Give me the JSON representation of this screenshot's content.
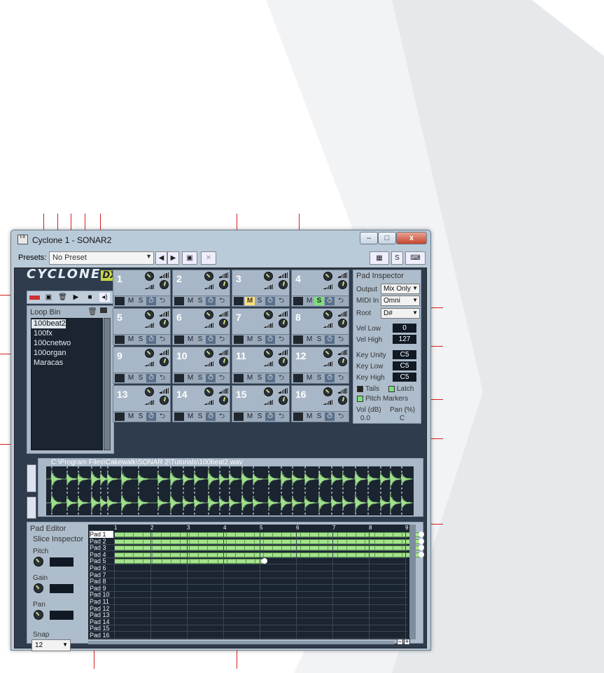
{
  "window": {
    "title": "Cyclone 1 - SONAR2",
    "sys_icon": "FX",
    "min_btn": "–",
    "max_btn": "□",
    "close_btn": "x"
  },
  "presets": {
    "label": "Presets:",
    "value": "No Preset",
    "prev": "◀",
    "next": "▶",
    "save_icon": "save-icon",
    "delete": "✕",
    "s_label": "S"
  },
  "logo": {
    "text": "CYCLONE",
    "dx": "DX",
    "i": "i"
  },
  "loop_bin": {
    "title": "Loop Bin",
    "items": [
      "100beat2",
      "100fx",
      "100cnetwo",
      "100organ",
      "Maracas"
    ],
    "selected": 0
  },
  "pads": [
    {
      "num": "1"
    },
    {
      "num": "2"
    },
    {
      "num": "3",
      "mute": true
    },
    {
      "num": "4"
    },
    {
      "num": "5"
    },
    {
      "num": "6"
    },
    {
      "num": "7"
    },
    {
      "num": "8"
    },
    {
      "num": "9"
    },
    {
      "num": "10"
    },
    {
      "num": "11"
    },
    {
      "num": "12"
    },
    {
      "num": "13"
    },
    {
      "num": "14"
    },
    {
      "num": "15"
    },
    {
      "num": "16"
    }
  ],
  "pad4_solo": true,
  "pad_buttons": {
    "m": "M",
    "s": "S",
    "clock": "⏱",
    "loop": "⮌"
  },
  "inspector": {
    "title": "Pad Inspector",
    "output_label": "Output",
    "output_value": "Mix Only",
    "midi_label": "MIDI In",
    "midi_value": "Omni",
    "root_label": "Root",
    "root_value": "D#",
    "vel_low_label": "Vel Low",
    "vel_low": "0",
    "vel_high_label": "Vel High",
    "vel_high": "127",
    "key_unity_label": "Key Unity",
    "key_unity": "C5",
    "key_low_label": "Key Low",
    "key_low": "C5",
    "key_high_label": "Key High",
    "key_high": "C5",
    "tails": "Tails",
    "latch": "Latch",
    "pitch_markers": "Pitch Markers",
    "vol_label": "Vol (dB)",
    "pan_label": "Pan (%)",
    "vol_value": "0.0",
    "pan_value": "C"
  },
  "waveform": {
    "path": "C:\\Program Files\\Cakewalk\\SONAR 2\\Tutorials\\100beat2.wav"
  },
  "pad_editor": {
    "title": "Pad Editor",
    "slice_inspector": "Slice Inspector",
    "pitch": "Pitch",
    "gain": "Gain",
    "pan": "Pan",
    "snap_label": "Snap",
    "snap_value": "12",
    "ruler": [
      "1",
      "2",
      "3",
      "4",
      "5",
      "6",
      "7",
      "8",
      "9"
    ],
    "rows": [
      "Pad 1",
      "Pad 2",
      "Pad 3",
      "Pad 4",
      "Pad 5",
      "Pad 6",
      "Pad 7",
      "Pad 8",
      "Pad 9",
      "Pad 10",
      "Pad 11",
      "Pad 12",
      "Pad 13",
      "Pad 14",
      "Pad 15",
      "Pad 16"
    ],
    "row_lengths_beats": [
      8.4,
      8.4,
      8.4,
      8.4,
      4.1,
      0,
      0,
      0,
      0,
      0,
      0,
      0,
      0,
      0,
      0,
      0
    ],
    "zoom_minus": "−",
    "zoom_plus": "+"
  }
}
